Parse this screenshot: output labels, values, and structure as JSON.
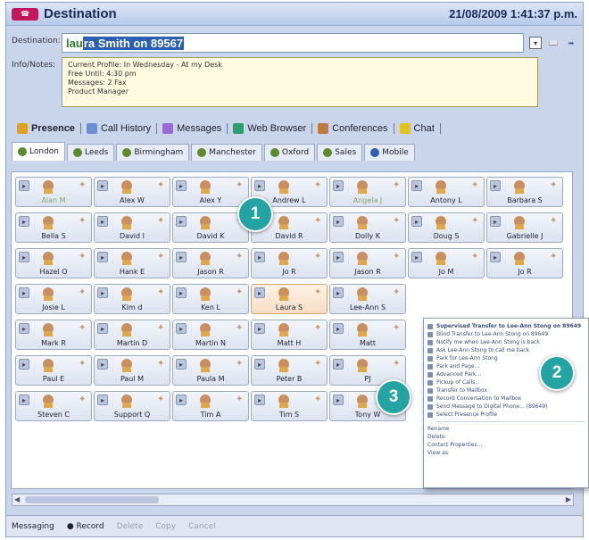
{
  "window": {
    "title": "Destination",
    "datetime": "21/08/2009 1:41:37 p.m.",
    "logo": "call-logo"
  },
  "destination": {
    "label": "Destination:",
    "value_part1": "lau",
    "value_part2": "ra Smith on 89567"
  },
  "notes": {
    "label": "Info/Notes:",
    "lines": [
      "Current Profile: In Wednesday - At my Desk",
      "Free Until: 4:30 pm",
      "Messages: 2 Fax",
      "Product Manager"
    ]
  },
  "main_tabs": [
    {
      "label": "Presence",
      "icon": "presence-icon",
      "color": "#e0a020"
    },
    {
      "label": "Call History",
      "icon": "call-history-icon",
      "color": "#6b8fd1"
    },
    {
      "label": "Messages",
      "icon": "messages-icon",
      "color": "#9a6bd1"
    },
    {
      "label": "Web Browser",
      "icon": "web-browser-icon",
      "color": "#2e9f6b"
    },
    {
      "label": "Conferences",
      "icon": "conferences-icon",
      "color": "#c07a3a"
    },
    {
      "label": "Chat",
      "icon": "chat-icon",
      "color": "#e3c21f"
    }
  ],
  "location_tabs": [
    "London",
    "Leeds",
    "Birmingham",
    "Manchester",
    "Oxford",
    "Sales",
    "Mobile"
  ],
  "contacts": [
    [
      "Alan M",
      "Alex W",
      "Alex Y",
      "Andrew L",
      "Angela J",
      "Antony L",
      "Barbara S"
    ],
    [
      "Bella S",
      "David I",
      "David K",
      "David R",
      "Dolly K",
      "Doug S",
      "Gabrielle J"
    ],
    [
      "Hazel O",
      "Hank E",
      "Jason R",
      "Jo R",
      "Jason R",
      "Jo M",
      "Jo R"
    ],
    [
      "Josie L",
      "Kim d",
      "Ken L",
      "Laura S",
      "Lee-Ann S",
      "",
      ""
    ],
    [
      "Mark R",
      "Martin D",
      "Martin N",
      "Matt H",
      "Matt",
      "",
      ""
    ],
    [
      "Paul E",
      "Paul M",
      "Paula M",
      "Peter B",
      "PJ",
      "",
      ""
    ],
    [
      "Steven C",
      "Support Q",
      "Tim A",
      "Tim S",
      "Tony W",
      "",
      ""
    ]
  ],
  "context_menu": [
    "Supervised Transfer to Lee-Ann Stong on 89649",
    "Blind Transfer to Lee-Ann Stong on 89649",
    "Notify me when Lee-Ann Stong is back",
    "Ask Lee-Ann Stong to call me back",
    "Park for Lee-Ann Stong",
    "Park and Page...",
    "Advanced Park...",
    "Pickup of Calls...",
    "Transfer to Mailbox",
    "Record Conversation to Mailbox",
    "Send Message to Digital Phone... (89649)",
    "Select Presence Profile",
    "Rename",
    "Delete",
    "Contact Properties...",
    "View as"
  ],
  "statusbar": {
    "messaging": "Messaging",
    "record": "Record",
    "delete": "Delete",
    "copy": "Copy",
    "cancel": "Cancel"
  },
  "callouts": [
    "1",
    "2",
    "3"
  ]
}
